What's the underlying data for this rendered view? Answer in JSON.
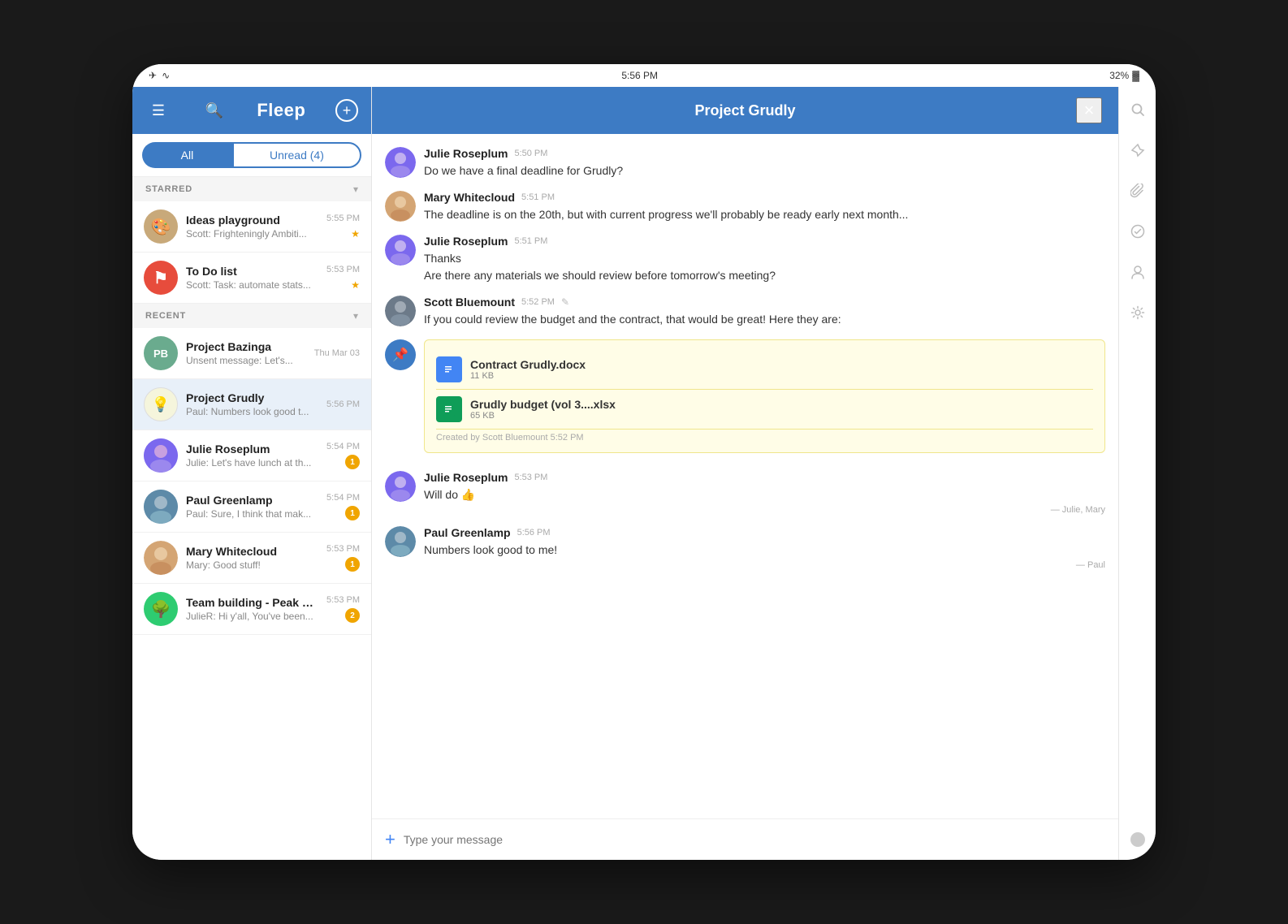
{
  "device": {
    "statusBar": {
      "time": "5:56 PM",
      "battery": "32%",
      "leftIcons": [
        "airplane",
        "wifi"
      ]
    }
  },
  "sidebar": {
    "logo": "Fleep",
    "menuIcon": "☰",
    "searchIcon": "🔍",
    "addIcon": "+",
    "filter": {
      "allLabel": "All",
      "unreadLabel": "Unread (4)"
    },
    "sections": {
      "starred": {
        "title": "STARRED",
        "items": [
          {
            "name": "Ideas playground",
            "preview": "Scott: Frighteningly Ambiti...",
            "time": "5:55 PM",
            "starred": true
          },
          {
            "name": "To Do list",
            "preview": "Scott: Task: automate stats...",
            "time": "5:53 PM",
            "starred": true
          }
        ]
      },
      "recent": {
        "title": "RECENT",
        "items": [
          {
            "name": "Project Bazinga",
            "initials": "PB",
            "preview": "Unsent message: Let's...",
            "time": "Thu Mar 03",
            "badge": null
          },
          {
            "name": "Project Grudly",
            "preview": "Paul: Numbers look good t...",
            "time": "5:56 PM",
            "badge": null,
            "active": true
          },
          {
            "name": "Julie Roseplum",
            "preview": "Julie: Let's have lunch at th...",
            "time": "5:54 PM",
            "badge": "1"
          },
          {
            "name": "Paul Greenlamp",
            "preview": "Paul: Sure, I think that mak...",
            "time": "5:54 PM",
            "badge": "1"
          },
          {
            "name": "Mary Whitecloud",
            "preview": "Mary: Good stuff!",
            "time": "5:53 PM",
            "badge": "1"
          },
          {
            "name": "Team building - Peak District",
            "preview": "JulieR: Hi y'all, You've been...",
            "time": "5:53 PM",
            "badge": "2"
          }
        ]
      }
    }
  },
  "chat": {
    "title": "Project Grudly",
    "closeLabel": "×",
    "messages": [
      {
        "sender": "Julie Roseplum",
        "time": "5:50 PM",
        "text": "Do we have a final deadline for Grudly?",
        "avatarColor": "#7b68ee"
      },
      {
        "sender": "Mary Whitecloud",
        "time": "5:51 PM",
        "text": "The deadline is on the 20th, but with current progress we'll probably be ready early next month...",
        "avatarColor": "#d4a574"
      },
      {
        "sender": "Julie Roseplum",
        "time": "5:51 PM",
        "text1": "Thanks",
        "text2": "Are there any materials we should review before tomorrow's meeting?",
        "avatarColor": "#7b68ee"
      },
      {
        "sender": "Scott Bluemount",
        "time": "5:52 PM",
        "text": "If you could review the budget and the contract, that would be great! Here they are:",
        "avatarColor": "#6c7a89",
        "hasEdit": true
      },
      {
        "isFile": true,
        "files": [
          {
            "name": "Contract Grudly.docx",
            "size": "11 KB",
            "type": "doc"
          },
          {
            "name": "Grudly budget (vol 3....xlsx",
            "size": "65 KB",
            "type": "xlsx"
          }
        ],
        "createdBy": "Created by Scott Bluemount 5:52 PM"
      },
      {
        "sender": "Julie Roseplum",
        "time": "5:53 PM",
        "text": "Will do 👍",
        "readBy": "— Julie, Mary",
        "avatarColor": "#7b68ee"
      },
      {
        "sender": "Paul Greenlamp",
        "time": "5:56 PM",
        "text": "Numbers look good to me!",
        "readBy": "— Paul",
        "avatarColor": "#5d8aa8"
      }
    ],
    "inputPlaceholder": "Type your message"
  },
  "rightPanel": {
    "icons": [
      {
        "name": "search-icon",
        "symbol": "🔍"
      },
      {
        "name": "pin-icon",
        "symbol": "📌"
      },
      {
        "name": "attachment-icon",
        "symbol": "📎"
      },
      {
        "name": "task-icon",
        "symbol": "✅"
      },
      {
        "name": "members-icon",
        "symbol": "👤"
      },
      {
        "name": "settings-icon",
        "symbol": "⚙"
      }
    ]
  }
}
